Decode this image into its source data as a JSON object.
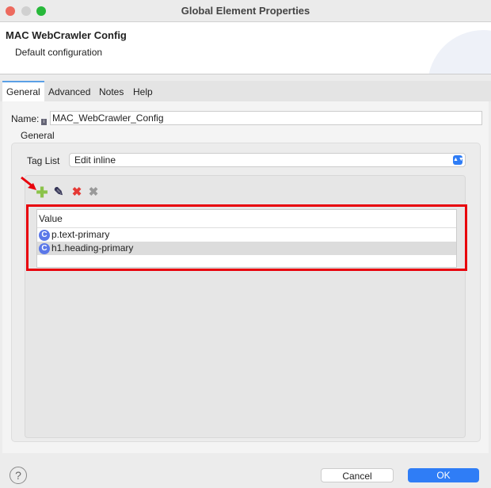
{
  "window": {
    "title": "Global Element Properties"
  },
  "header": {
    "title": "MAC WebCrawler Config",
    "subtitle": "Default configuration"
  },
  "tabs": [
    {
      "label": "General",
      "active": true
    },
    {
      "label": "Advanced"
    },
    {
      "label": "Notes"
    },
    {
      "label": "Help"
    }
  ],
  "form": {
    "name_label": "Name:",
    "name_value": "MAC_WebCrawler_Config",
    "section": "General",
    "tag_list_label": "Tag List",
    "tag_list_value": "Edit inline"
  },
  "table": {
    "header": "Value",
    "rows": [
      "p.text-primary",
      "h1.heading-primary"
    ],
    "selected_index": 1
  },
  "footer": {
    "cancel": "Cancel",
    "ok": "OK"
  },
  "colors": {
    "accent": "#2f7df6",
    "highlight": "#e8000b"
  }
}
